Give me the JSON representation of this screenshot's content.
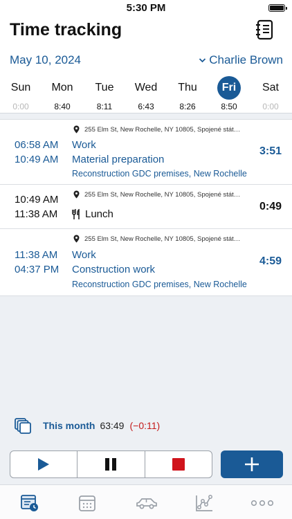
{
  "status_bar": {
    "time": "5:30 PM"
  },
  "header": {
    "title": "Time tracking"
  },
  "date_label": "May 10, 2024",
  "user": {
    "name": "Charlie Brown"
  },
  "week": [
    {
      "name": "Sun",
      "total": "0:00",
      "dim": true
    },
    {
      "name": "Mon",
      "total": "8:40"
    },
    {
      "name": "Tue",
      "total": "8:11"
    },
    {
      "name": "Wed",
      "total": "6:43"
    },
    {
      "name": "Thu",
      "total": "8:26"
    },
    {
      "name": "Fri",
      "total": "8:50",
      "selected": true
    },
    {
      "name": "Sat",
      "total": "0:00",
      "dim": true
    }
  ],
  "entries": [
    {
      "location": "255 Elm St, New Rochelle, NY 10805, Spojené stát…",
      "start": "06:58 AM",
      "end": "10:49 AM",
      "type": "Work",
      "activity": "Material preparation",
      "project": "Reconstruction GDC premises, New Rochelle",
      "duration": "3:51"
    },
    {
      "location": "255 Elm St, New Rochelle, NY 10805, Spojené stát…",
      "start": "10:49 AM",
      "end": "11:38 AM",
      "type": "Lunch",
      "duration": "0:49"
    },
    {
      "location": "255 Elm St, New Rochelle, NY 10805, Spojené stát…",
      "start": "11:38 AM",
      "end": "04:37 PM",
      "type": "Work",
      "activity": "Construction work",
      "project": "Reconstruction GDC premises, New Rochelle",
      "duration": "4:59"
    }
  ],
  "summary": {
    "label": "This month",
    "total": "63:49",
    "diff": "(−0:11)"
  },
  "colors": {
    "accent": "#1a5a96",
    "negative": "#c41a1a",
    "stop": "#d0141c"
  },
  "icons": {
    "notebook": "notebook-icon",
    "chevron": "chevron-down-icon",
    "pin": "location-pin-icon",
    "fork_knife": "fork-knife-icon",
    "months": "stacked-pages-icon",
    "play": "play-icon",
    "pause": "pause-icon",
    "stop": "stop-icon",
    "add": "plus-icon",
    "tabs": [
      "timesheet-icon",
      "calendar-icon",
      "car-icon",
      "stats-icon",
      "more-icon"
    ]
  }
}
